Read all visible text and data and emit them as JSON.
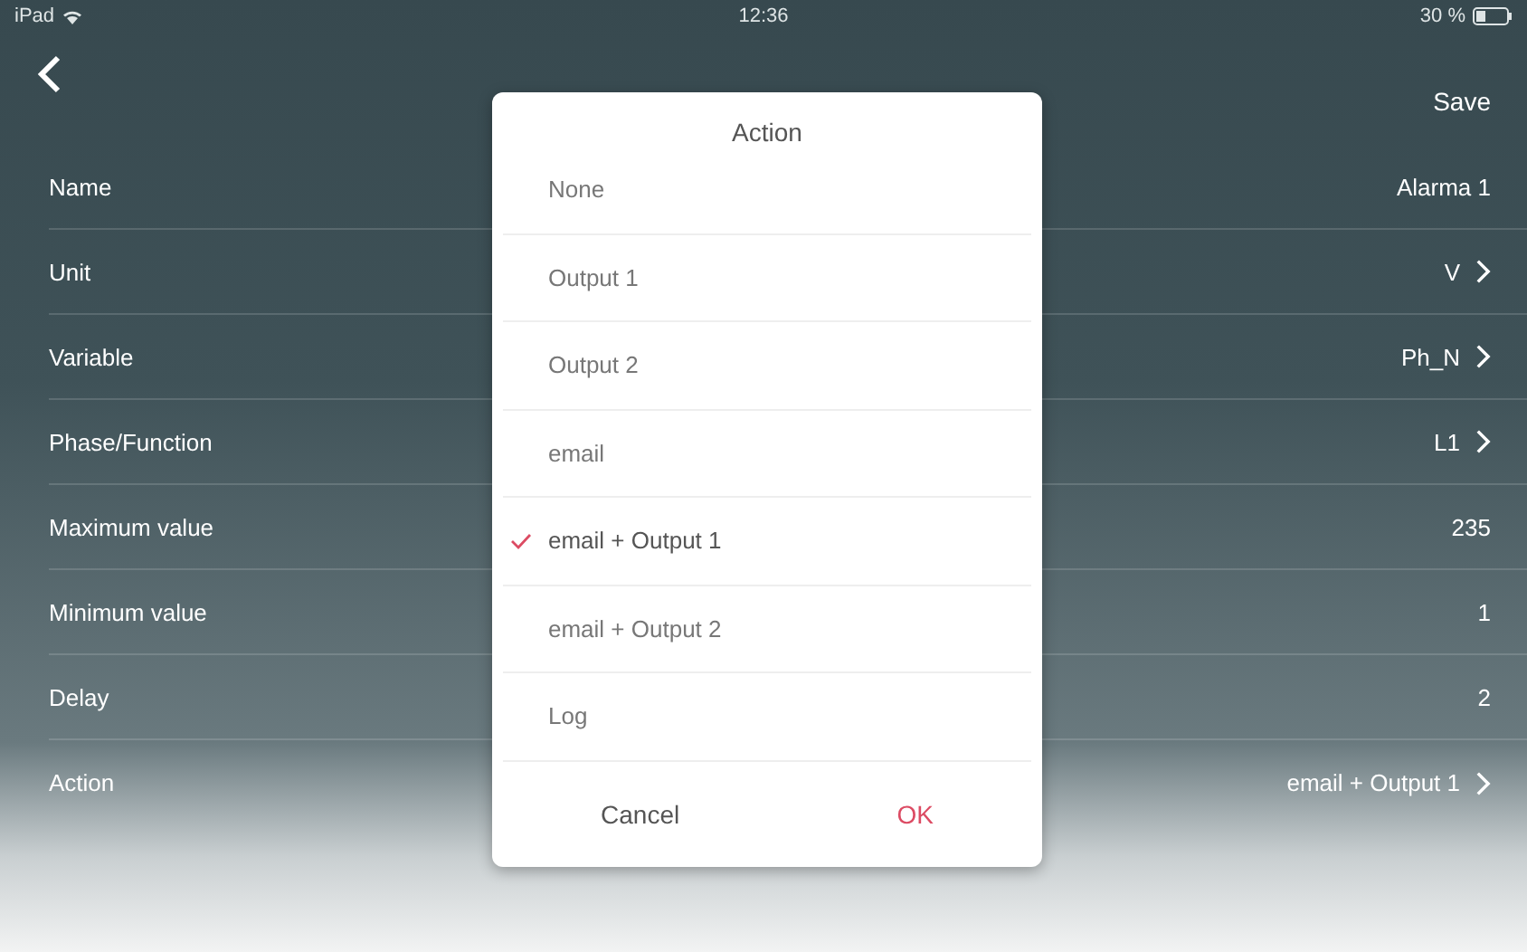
{
  "status_bar": {
    "device": "iPad",
    "time": "12:36",
    "battery": "30 %"
  },
  "nav": {
    "save": "Save"
  },
  "rows": [
    {
      "label": "Name",
      "value": "Alarma 1",
      "chevron": false
    },
    {
      "label": "Unit",
      "value": "V",
      "chevron": true
    },
    {
      "label": "Variable",
      "value": "Ph_N",
      "chevron": true
    },
    {
      "label": "Phase/Function",
      "value": "L1",
      "chevron": true
    },
    {
      "label": "Maximum value",
      "value": "235",
      "chevron": false
    },
    {
      "label": "Minimum value",
      "value": "1",
      "chevron": false
    },
    {
      "label": "Delay",
      "value": "2",
      "chevron": false
    },
    {
      "label": "Action",
      "value": "email + Output 1",
      "chevron": true
    }
  ],
  "dialog": {
    "title": "Action",
    "options": [
      {
        "label": "None",
        "selected": false
      },
      {
        "label": "Output 1",
        "selected": false
      },
      {
        "label": "Output 2",
        "selected": false
      },
      {
        "label": "email",
        "selected": false
      },
      {
        "label": "email + Output 1",
        "selected": true
      },
      {
        "label": "email + Output 2",
        "selected": false
      },
      {
        "label": "Log",
        "selected": false
      }
    ],
    "cancel": "Cancel",
    "ok": "OK"
  }
}
